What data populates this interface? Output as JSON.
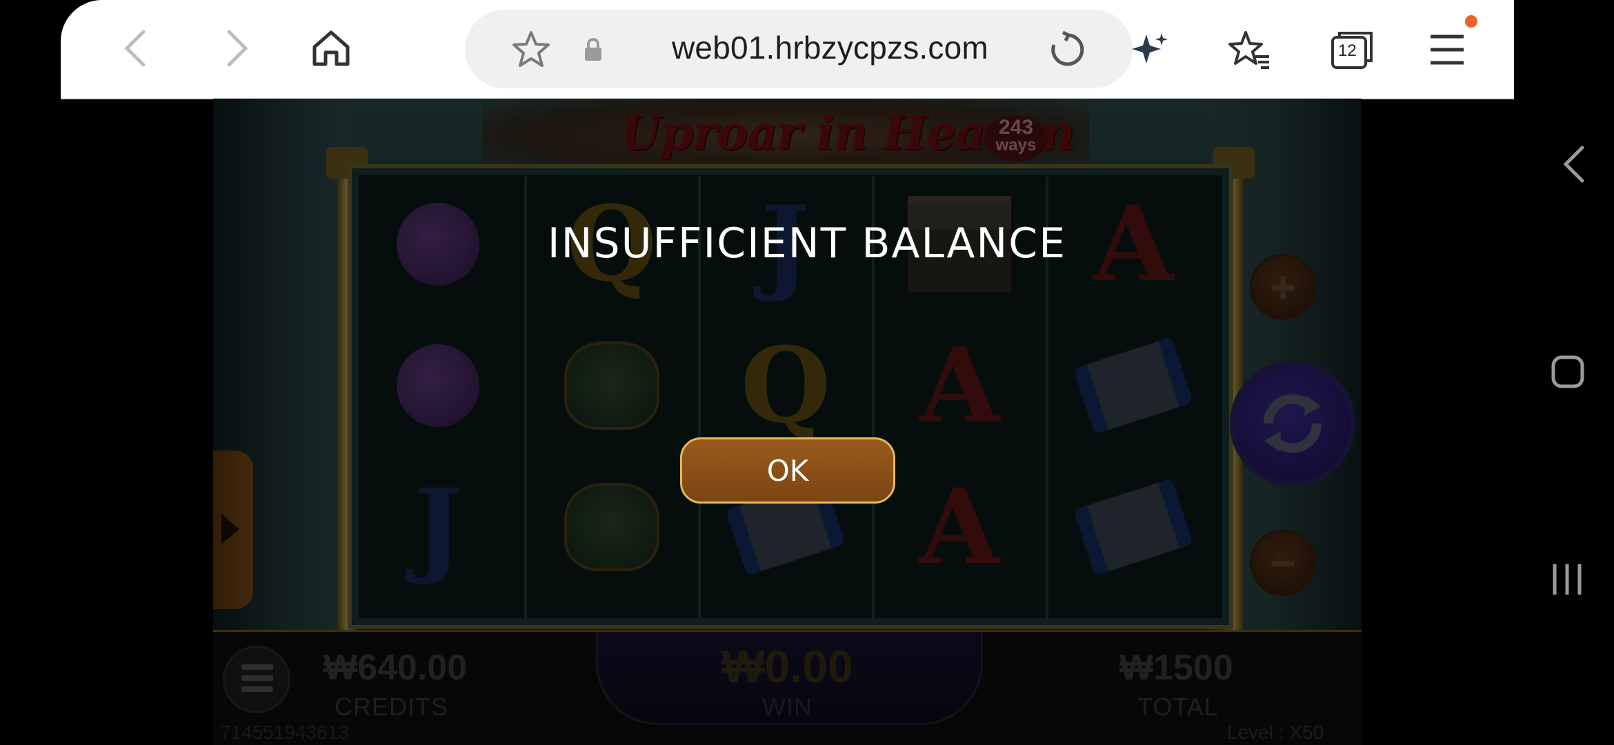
{
  "browser": {
    "url": "web01.hrbzycpzs.com",
    "tab_count": "12",
    "icons": [
      "back-icon",
      "forward-icon",
      "home-icon",
      "bookmark-star-icon",
      "lock-icon",
      "reload-icon",
      "ai-sparkle-icon",
      "bookmarks-icon",
      "tabs-icon",
      "menu-icon"
    ],
    "notification_color": "#e8622c"
  },
  "game": {
    "title": "Uproar in Heaven",
    "ways_number": "243",
    "ways_word": "ways",
    "reels": [
      [
        "gourd",
        "gourd",
        "J"
      ],
      [
        "Q",
        "pot",
        "pot"
      ],
      [
        "J",
        "Q",
        "scroll"
      ],
      [
        "temple",
        "A",
        "A"
      ],
      [
        "A",
        "scroll",
        "scroll"
      ]
    ],
    "credits_value": "₩640.00",
    "credits_label": "CREDITS",
    "win_value": "₩0.00",
    "win_label": "WIN",
    "total_value": "₩1500",
    "total_label": "TOTAL",
    "player_id": "714551943613",
    "level_text": "Level : X50"
  },
  "dialog": {
    "message": "INSUFFICIENT BALANCE",
    "ok_label": "OK",
    "button_color": "#8a4d17",
    "border_color": "#e7b95a"
  }
}
